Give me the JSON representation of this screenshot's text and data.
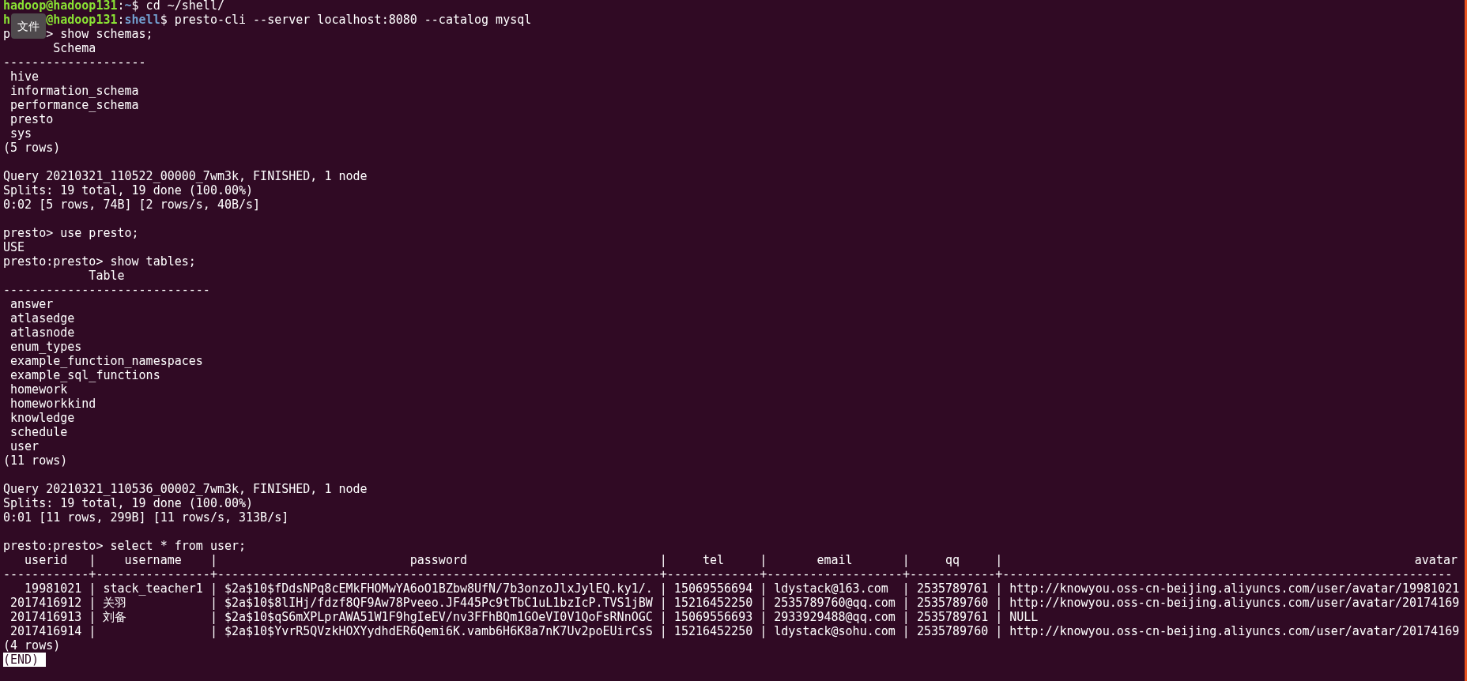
{
  "tooltip": "文件",
  "lines": [
    {
      "kind": "shell",
      "user_parts": [
        "hadoop@hadoop131"
      ],
      "sep": ":",
      "path": "~",
      "symbol": "$",
      "command": " cd ~/shell/"
    },
    {
      "kind": "shell",
      "user_parts": [
        "h",
        "@hadoop131"
      ],
      "sep": ":",
      "path": "shell",
      "symbol": "$",
      "command": " presto-cli --server localhost:8080 --catalog mysql"
    },
    {
      "kind": "presto",
      "prompt_parts": [
        "p",
        ">"
      ],
      "command": " show schemas;"
    },
    {
      "kind": "output",
      "text": "       Schema"
    },
    {
      "kind": "output",
      "text": "--------------------"
    },
    {
      "kind": "output",
      "text": " hive"
    },
    {
      "kind": "output",
      "text": " information_schema"
    },
    {
      "kind": "output",
      "text": " performance_schema"
    },
    {
      "kind": "output",
      "text": " presto"
    },
    {
      "kind": "output",
      "text": " sys"
    },
    {
      "kind": "output",
      "text": "(5 rows)"
    },
    {
      "kind": "blank"
    },
    {
      "kind": "output",
      "text": "Query 20210321_110522_00000_7wm3k, FINISHED, 1 node"
    },
    {
      "kind": "output",
      "text": "Splits: 19 total, 19 done (100.00%)"
    },
    {
      "kind": "output",
      "text": "0:02 [5 rows, 74B] [2 rows/s, 40B/s]"
    },
    {
      "kind": "blank"
    },
    {
      "kind": "presto",
      "prompt_parts": [
        "presto>"
      ],
      "command": " use presto;"
    },
    {
      "kind": "output",
      "text": "USE"
    },
    {
      "kind": "presto",
      "prompt_parts": [
        "presto:presto>"
      ],
      "command": " show tables;"
    },
    {
      "kind": "output",
      "text": "            Table"
    },
    {
      "kind": "output",
      "text": "-----------------------------"
    },
    {
      "kind": "output",
      "text": " answer"
    },
    {
      "kind": "output",
      "text": " atlasedge"
    },
    {
      "kind": "output",
      "text": " atlasnode"
    },
    {
      "kind": "output",
      "text": " enum_types"
    },
    {
      "kind": "output",
      "text": " example_function_namespaces"
    },
    {
      "kind": "output",
      "text": " example_sql_functions"
    },
    {
      "kind": "output",
      "text": " homework"
    },
    {
      "kind": "output",
      "text": " homeworkkind"
    },
    {
      "kind": "output",
      "text": " knowledge"
    },
    {
      "kind": "output",
      "text": " schedule"
    },
    {
      "kind": "output",
      "text": " user"
    },
    {
      "kind": "output",
      "text": "(11 rows)"
    },
    {
      "kind": "blank"
    },
    {
      "kind": "output",
      "text": "Query 20210321_110536_00002_7wm3k, FINISHED, 1 node"
    },
    {
      "kind": "output",
      "text": "Splits: 19 total, 19 done (100.00%)"
    },
    {
      "kind": "output",
      "text": "0:01 [11 rows, 299B] [11 rows/s, 313B/s]"
    },
    {
      "kind": "blank"
    },
    {
      "kind": "presto",
      "prompt_parts": [
        "presto:presto>"
      ],
      "command": " select * from user;"
    }
  ],
  "table": {
    "divider": "|",
    "columns": [
      {
        "name": "userid",
        "kind": "number"
      },
      {
        "name": "username",
        "kind": "text"
      },
      {
        "name": "password",
        "kind": "text"
      },
      {
        "name": "tel",
        "kind": "text"
      },
      {
        "name": "email",
        "kind": "text"
      },
      {
        "name": "qq",
        "kind": "text"
      },
      {
        "name": "avatar",
        "kind": "wide"
      }
    ],
    "rule": "------------+----------------+--------------------------------------------------------------+-------------+-------------------+------------+---------------------------------------------------------------",
    "rows": [
      {
        "cells": [
          "19981021",
          "stack_teacher1",
          "$2a$10$fDdsNPq8cEMkFHOMwYA6oO1BZbw8UfN/7b3onzoJlxJylEQ.ky1/.",
          "15069556694",
          "ldystack@163.com",
          "2535789761",
          "http://knowyou.oss-cn-beijing.aliyuncs.com/user/avatar/19981021"
        ]
      },
      {
        "cells": [
          "2017416912",
          "关羽",
          "$2a$10$8lIHj/fdzf8QF9Aw78Pveeo.JF445Pc9tTbC1uL1bzIcP.TVS1jBW",
          "15216452250",
          "2535789760@qq.com",
          "2535789760",
          "http://knowyou.oss-cn-beijing.aliyuncs.com/user/avatar/20174169"
        ]
      },
      {
        "cells": [
          "2017416913",
          "刘备",
          "$2a$10$qS6mXPLprAWA51W1F9hgIeEV/nv3FFhBQm1GOeVI0V1QoFsRNnOGC",
          "15069556693",
          "2933929488@qq.com",
          "2535789761",
          "NULL"
        ]
      },
      {
        "cells": [
          "2017416914",
          "",
          "$2a$10$YvrR5QVzkHOXYydhdER6Qemi6K.vamb6H6K8a7nK7Uv2poEUirCsS",
          "15216452250",
          "ldystack@sohu.com",
          "2535789760",
          "http://knowyou.oss-cn-beijing.aliyuncs.com/user/avatar/20174169"
        ]
      }
    ],
    "footer": "(4 rows)"
  },
  "pager": "(END)"
}
